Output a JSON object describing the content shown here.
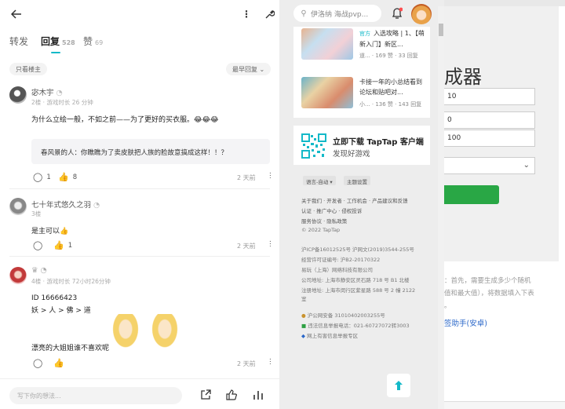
{
  "background": {
    "title": "成器",
    "inputs": [
      "10",
      "0",
      "100"
    ],
    "desc_line1": "：首先，需要生成多少个随机",
    "desc_line2": "值和最大值），将数据填入下表",
    "desc_line3": "。",
    "link": "签助手(安卓)"
  },
  "left": {
    "tabs": [
      {
        "label": "转发",
        "count": ""
      },
      {
        "label": "回复",
        "count": "528"
      },
      {
        "label": "赞",
        "count": "69"
      }
    ],
    "filter_left": "只看楼主",
    "filter_right": "最早回复",
    "comments": [
      {
        "name": "宓木宇",
        "meta": "2楼 · 游戏时长 26 分钟",
        "text": "为什么立绘一般，不如之前——为了更好的买衣服。😂😂😂",
        "quote_user": "春风景的人：",
        "quote_text": "你瞧瞧为了卖皮肤把人族的脸故意搞成这样！！？",
        "comments": "1",
        "likes": "8",
        "date": "2 天前"
      },
      {
        "name": "七十年式悠久之羽",
        "meta": "3楼",
        "text": "是主可以👍",
        "comments": "",
        "likes": "1",
        "date": "2 天前"
      },
      {
        "name": "",
        "meta": "4楼 · 游戏时长 72小时26分钟",
        "line1": "ID  16666423",
        "line2": "妖 > 人 > 佛 > 道",
        "line3": "漂亮的大姐姐谁不喜欢呢",
        "comments": "",
        "likes": "",
        "date": "2 天前"
      }
    ],
    "input_placeholder": "写下你的想法..."
  },
  "right": {
    "search_placeholder": "伊洛纳 海战pvp...",
    "cards": [
      {
        "official": "官方",
        "title": "入选攻略 | 1、【萌新入门】新区...",
        "meta": "道... · 169 赞 · 33 回复"
      },
      {
        "official": "",
        "title": "卡接一年的小总结看到论坛和贴吧对...",
        "meta": "小... · 136 赞 · 143 回复"
      }
    ],
    "download_title": "立即下载 TapTap 客户端",
    "download_sub": "发现好游戏",
    "chip_lang": "语言-自动 ▾",
    "chip_theme": "主题设置",
    "footer": [
      "关于我们 · 开发者 · 工作机会 · 产品建议和反馈",
      "认证 · 推广中心 · 侵权投诉",
      "服务协议 · 隐私政策",
      "© 2022 TapTap",
      "沪ICP备16012525号   沪网文(2019)3544-255号",
      "经营许可证编号: 沪B2-20170322",
      "易玩（上海）网络科技有限公司",
      "公司地址: 上海市静安区灵石路 718 号 B1 北楼",
      "注册地址: 上海市闵行区紫星路 588 号 2 幢 2122",
      "室"
    ],
    "footer2": [
      "沪公网安备 31010402003255号",
      "违法信息举报电话：021-60727072转3003",
      "网上有害信息举报专区"
    ]
  },
  "colors": {
    "accent": "#14b9c8",
    "green": "#29a745"
  }
}
